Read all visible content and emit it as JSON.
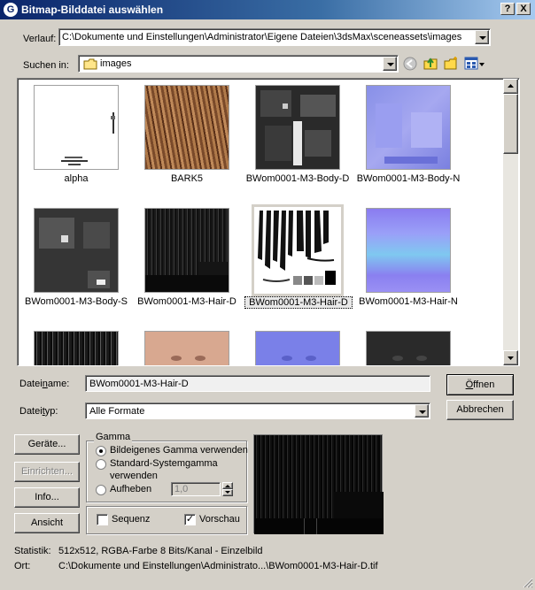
{
  "window": {
    "title": "Bitmap-Bilddatei auswählen",
    "help_btn": "?",
    "close_btn": "X"
  },
  "history": {
    "label": "Verlauf:",
    "value": "C:\\Dokumente und Einstellungen\\Administrator\\Eigene Dateien\\3dsMax\\sceneassets\\images"
  },
  "lookin": {
    "label": "Suchen in:",
    "value": "images"
  },
  "files": [
    {
      "name": "alpha"
    },
    {
      "name": "BARK5"
    },
    {
      "name": "BWom0001-M3-Body-D"
    },
    {
      "name": "BWom0001-M3-Body-N"
    },
    {
      "name": "BWom0001-M3-Body-S"
    },
    {
      "name": "BWom0001-M3-Hair-D"
    },
    {
      "name": "BWom0001-M3-Hair-D"
    },
    {
      "name": "BWom0001-M3-Hair-N"
    },
    {
      "name": ""
    },
    {
      "name": ""
    },
    {
      "name": ""
    },
    {
      "name": ""
    }
  ],
  "filename": {
    "label": "Dateiname:",
    "value": "BWom0001-M3-Hair-D"
  },
  "filetype": {
    "label": "Dateityp:",
    "value": "Alle Formate"
  },
  "buttons": {
    "open": "Öffnen",
    "cancel": "Abbrechen",
    "devices": "Geräte...",
    "setup": "Einrichten...",
    "info": "Info...",
    "view": "Ansicht"
  },
  "gamma": {
    "title": "Gamma",
    "opt_own": "Bildeigenes Gamma verwenden",
    "opt_system_1": "Standard-Systemgamma",
    "opt_system_2": "verwenden",
    "opt_override": "Aufheben",
    "override_value": "1,0"
  },
  "sequence": {
    "label": "Sequenz"
  },
  "preview": {
    "label": "Vorschau",
    "check": "✓"
  },
  "stats": {
    "label": "Statistik:",
    "value": "512x512, RGBA-Farbe 8 Bits/Kanal - Einzelbild"
  },
  "location": {
    "label": "Ort:",
    "value": "C:\\Dokumente und Einstellungen\\Administrato...\\BWom0001-M3-Hair-D.tif"
  }
}
